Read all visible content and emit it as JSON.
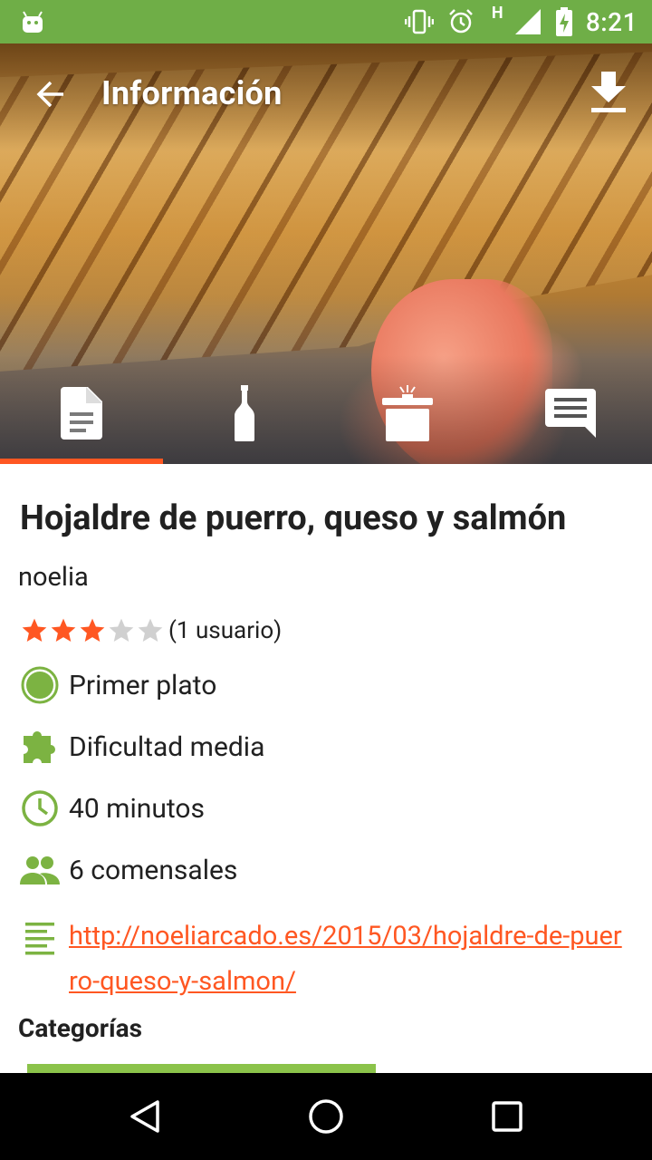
{
  "status_bar": {
    "time": "8:21",
    "network_label": "H",
    "icons": [
      "android-icon",
      "vibrate-icon",
      "alarm-icon",
      "signal-icon",
      "battery-charging-icon"
    ],
    "color": "#6fae47"
  },
  "toolbar": {
    "title": "Información",
    "back_icon": "arrow-back-icon",
    "download_icon": "download-icon"
  },
  "tabs": [
    {
      "icon": "document-icon",
      "selected": true
    },
    {
      "icon": "bottle-icon",
      "selected": false
    },
    {
      "icon": "pot-icon",
      "selected": false
    },
    {
      "icon": "comment-icon",
      "selected": false
    }
  ],
  "recipe": {
    "title": "Hojaldre de puerro, queso y salmón",
    "author": "noelia",
    "rating": 3,
    "rating_max": 5,
    "rating_text": "(1 usuario)",
    "course": "Primer plato",
    "difficulty": "Dificultad media",
    "time": "40 minutos",
    "servings": "6 comensales",
    "url": "http://noeliarcado.es/2015/03/hojaldre-de-puerro-queso-y-salmon/",
    "categories_title": "Categorías"
  },
  "colors": {
    "accent": "#ff5722",
    "green": "#6fae47",
    "icon_green": "#7cb342",
    "star_empty": "#d0d0d0"
  }
}
